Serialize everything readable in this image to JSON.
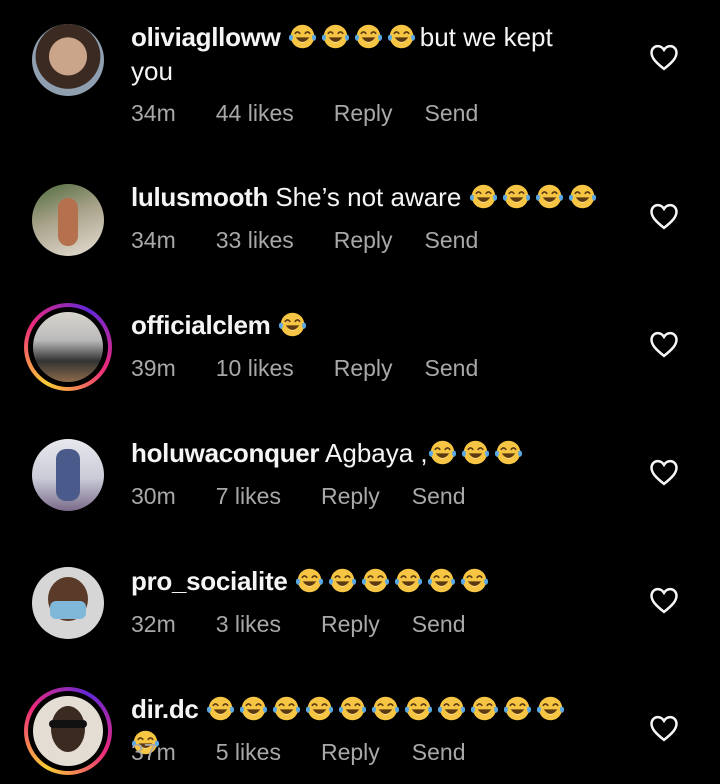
{
  "comments": [
    {
      "username": "oliviaglloww",
      "emoji_count": 4,
      "text": "but we kept you",
      "time": "34m",
      "likes": "44 likes",
      "reply": "Reply",
      "send": "Send",
      "ring": false
    },
    {
      "username": "lulusmooth",
      "text_before": "She’s not aware ",
      "emoji_count": 4,
      "time": "34m",
      "likes": "33 likes",
      "reply": "Reply",
      "send": "Send",
      "ring": false
    },
    {
      "username": "officialclem",
      "emoji_count": 1,
      "time": "39m",
      "likes": "10 likes",
      "reply": "Reply",
      "send": "Send",
      "ring": true
    },
    {
      "username": "holuwaconquer",
      "text_before": "Agbaya ,",
      "emoji_count": 3,
      "time": "30m",
      "likes": "7 likes",
      "reply": "Reply",
      "send": "Send",
      "ring": false
    },
    {
      "username": "pro_socialite",
      "emoji_count": 6,
      "time": "32m",
      "likes": "3 likes",
      "reply": "Reply",
      "send": "Send",
      "ring": false
    },
    {
      "username": "dir.dc",
      "emoji_count": 12,
      "time": "37m",
      "likes": "5 likes",
      "reply": "Reply",
      "send": "Send",
      "ring": true
    }
  ],
  "emoji_name": "face-with-tears-of-joy",
  "icons": {
    "like": "heart-outline-icon"
  },
  "colors": {
    "background": "#000000",
    "text": "#f5f5f5",
    "meta": "#a8a8a8",
    "emoji": "#f7c544",
    "tear": "#5aa9e6"
  }
}
